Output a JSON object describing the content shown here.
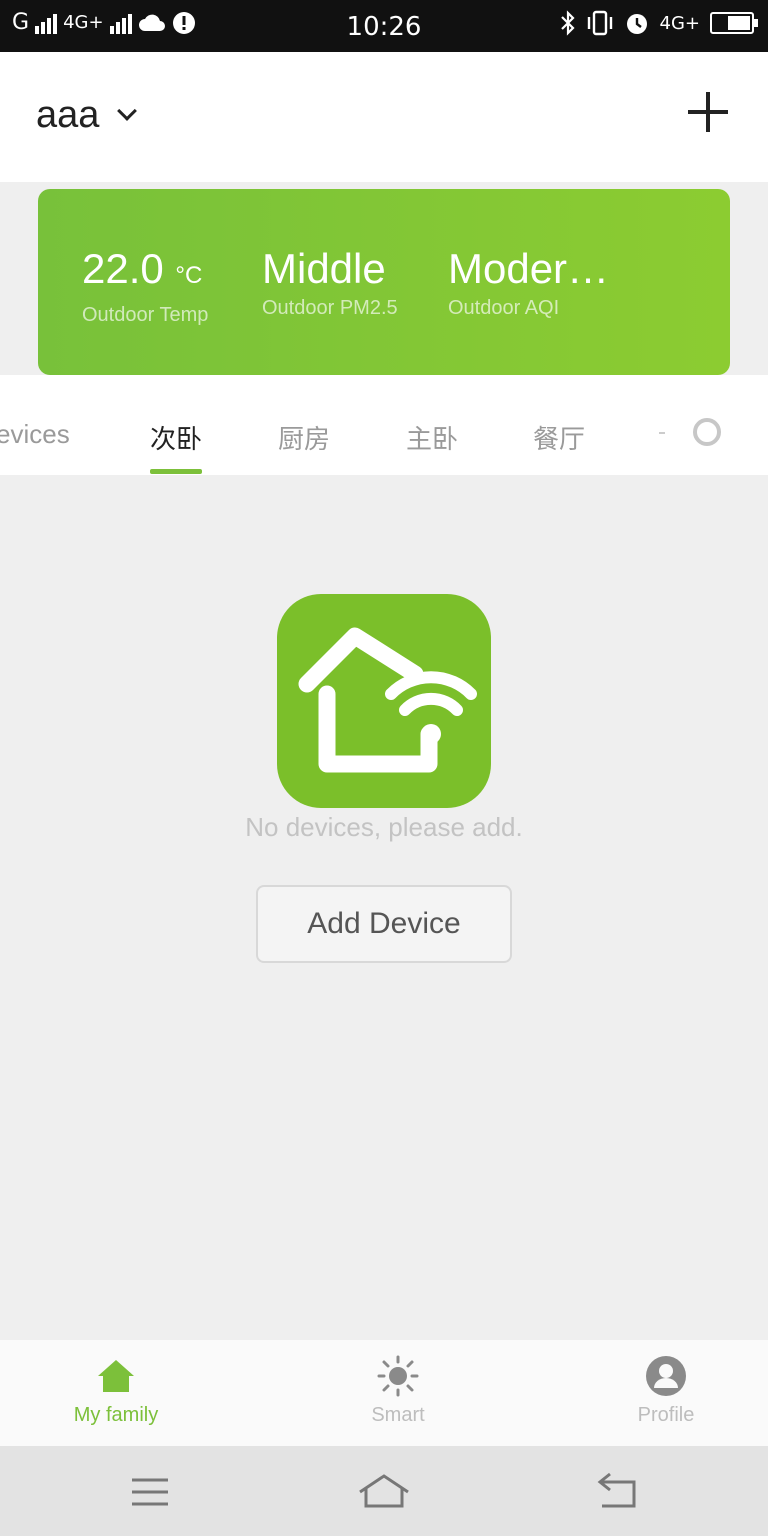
{
  "status_bar": {
    "left_text_g": "G",
    "left_text_4g": "4G+",
    "time": "10:26",
    "right_text_4g": "4G+"
  },
  "header": {
    "family_name": "aaa"
  },
  "weather": {
    "temp_value": "22.0",
    "temp_unit": "°C",
    "temp_label": "Outdoor Temp",
    "pm_value": "Middle",
    "pm_label": "Outdoor PM2.5",
    "aqi_value": "Moder…",
    "aqi_label": "Outdoor AQI"
  },
  "tabs": [
    {
      "label": "evices"
    },
    {
      "label": "次卧"
    },
    {
      "label": "厨房"
    },
    {
      "label": "主卧"
    },
    {
      "label": "餐厅"
    }
  ],
  "empty_state": {
    "message": "No devices, please add.",
    "button_label": "Add Device"
  },
  "bottom_nav": {
    "items": [
      {
        "label": "My family"
      },
      {
        "label": "Smart"
      },
      {
        "label": "Profile"
      }
    ]
  },
  "colors": {
    "accent": "#7cc03a",
    "card_start": "#78c13a",
    "card_end": "#8ccc31"
  },
  "icons": [
    "signal-icon",
    "cloud-icon",
    "alert-icon",
    "bluetooth-icon",
    "vibrate-icon",
    "alarm-icon",
    "battery-icon",
    "chevron-down-icon",
    "plus-icon",
    "gear-icon",
    "smart-home-wifi-icon",
    "home-icon",
    "sun-icon",
    "profile-icon",
    "menu-icon",
    "home-outline-icon",
    "back-icon"
  ]
}
